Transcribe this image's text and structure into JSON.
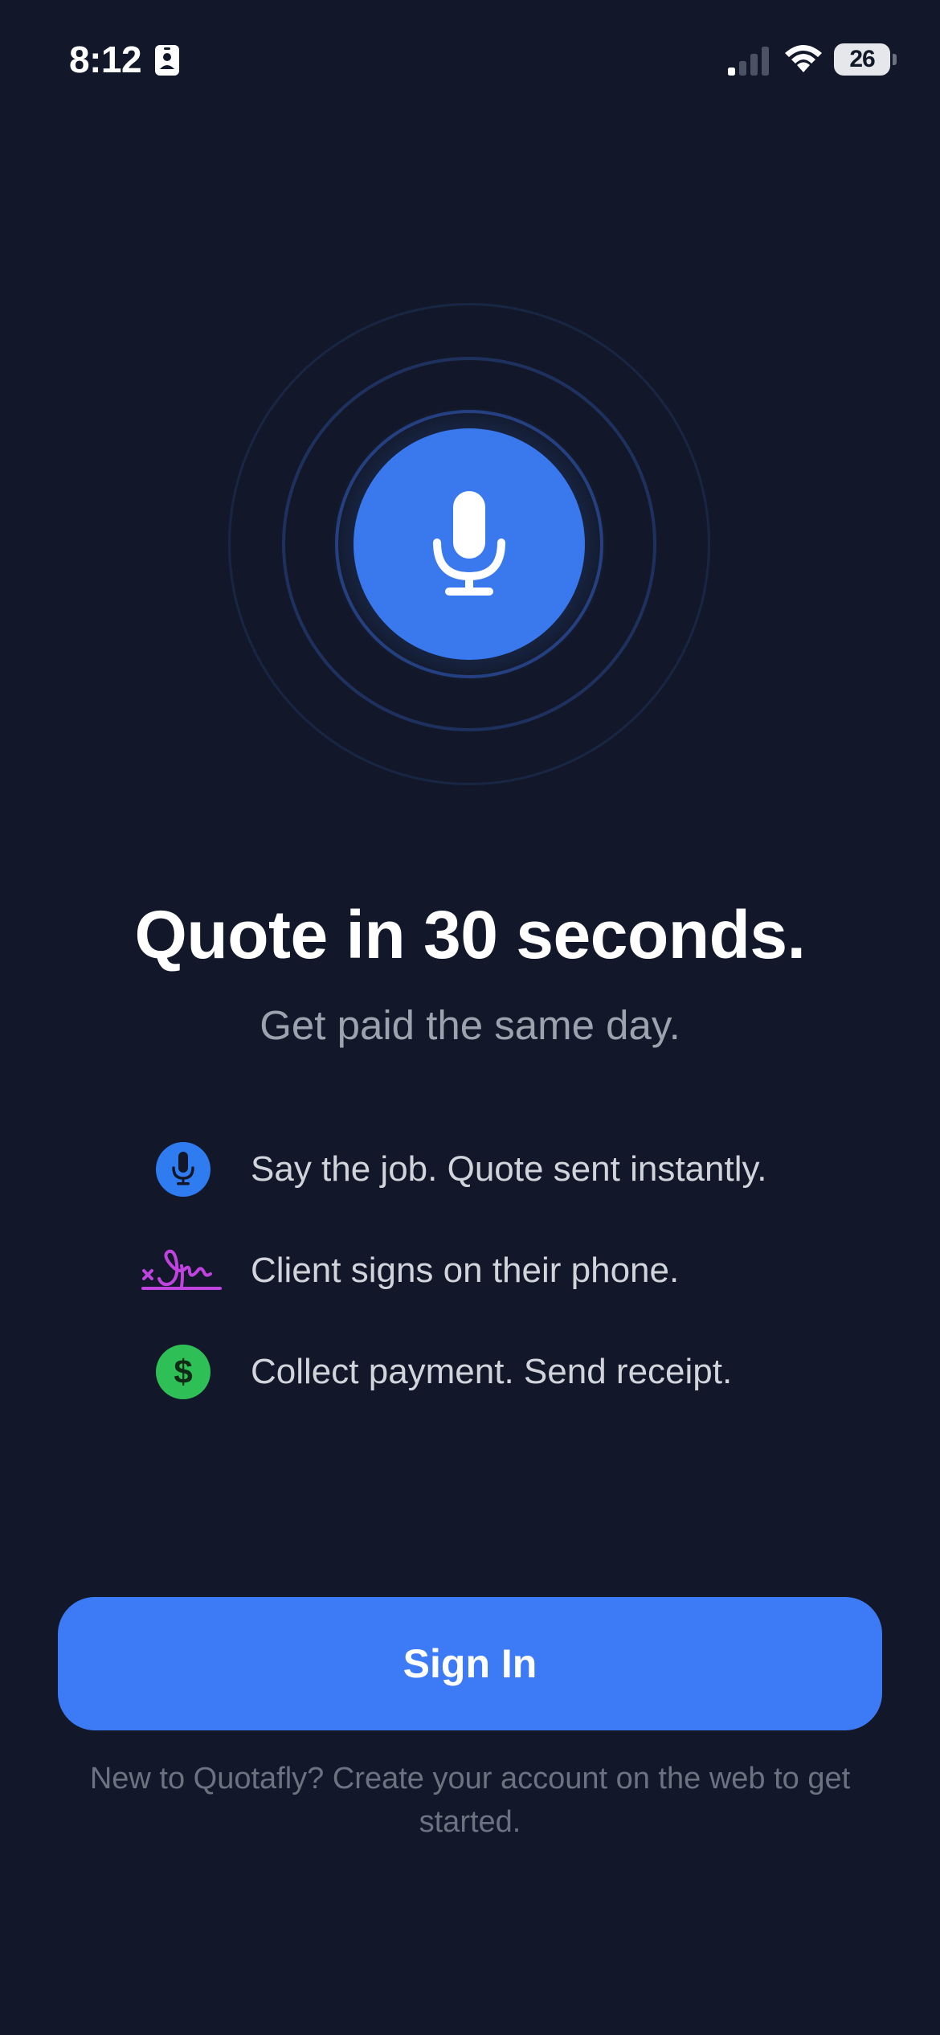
{
  "status_bar": {
    "time": "8:12",
    "battery": "26",
    "icons": [
      "id-card-icon",
      "cellular-signal-icon",
      "wifi-icon",
      "battery-icon"
    ]
  },
  "hero": {
    "icon": "microphone-icon",
    "headline": "Quote in 30 seconds.",
    "subheadline": "Get paid the same day."
  },
  "features": [
    {
      "icon": "microphone-icon",
      "text": "Say the job. Quote sent instantly.",
      "color": "#2f7cf0"
    },
    {
      "icon": "signature-icon",
      "text": "Client signs on their phone.",
      "color": "#c043e0"
    },
    {
      "icon": "dollar-icon",
      "text": "Collect payment. Send receipt.",
      "color": "#2fbf57"
    }
  ],
  "actions": {
    "sign_in_label": "Sign In"
  },
  "footer": {
    "note": "New to Quotafly? Create your account on the web to get started."
  },
  "colors": {
    "background": "#121829",
    "accent": "#3d7bf6",
    "headline": "#ffffff",
    "subtext": "#9ca3af"
  }
}
